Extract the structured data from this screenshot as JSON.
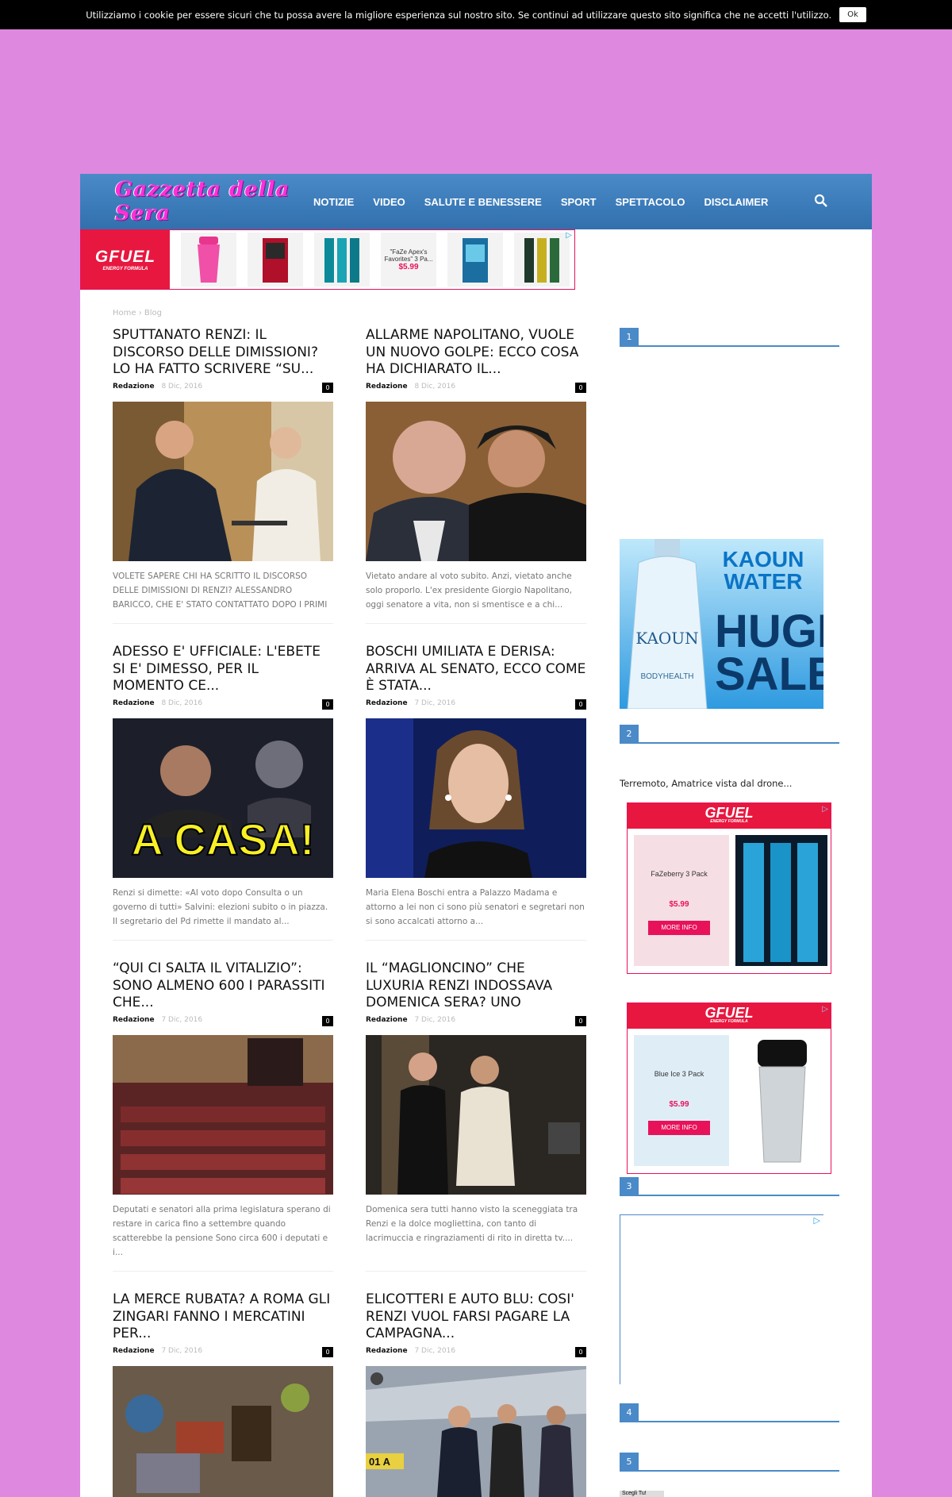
{
  "cookie_bar": {
    "text": "Utilizziamo i cookie per essere sicuri che tu possa avere la migliore esperienza sul nostro sito. Se continui ad utilizzare questo sito significa che ne accetti l'utilizzo.",
    "ok_label": "Ok"
  },
  "header": {
    "logo": "Gazzetta della Sera",
    "nav": [
      "NOTIZIE",
      "VIDEO",
      "SALUTE E BENESSERE",
      "SPORT",
      "SPETTACOLO",
      "DISCLAIMER"
    ],
    "search_icon": "search-icon"
  },
  "ad_banner": {
    "brand": "GFUEL",
    "brand_sub": "ENERGY FORMULA",
    "promo_text": "\"FaZe Apex's Favorites\" 3 Pa...",
    "promo_price": "$5.99"
  },
  "breadcrumb": {
    "home": "Home",
    "sep": "›",
    "current": "Blog"
  },
  "articles": [
    {
      "title": "SPUTTANATO RENZI: IL DISCORSO DELLE DIMISSIONI? LO HA FATTO SCRIVERE “SU...",
      "author": "Redazione",
      "date": "8 Dic, 2016",
      "comments": "0",
      "excerpt": "VOLETE SAPERE CHI HA SCRITTO IL DISCORSO DELLE DIMISSIONI DI RENZI? ALESSANDRO BARICCO, CHE E' STATO CONTATTATO DOPO I PRIMI EXIT POLL – MA..."
    },
    {
      "title": "ALLARME NAPOLITANO, VUOLE UN NUOVO GOLPE: ECCO COSA HA DICHIARATO IL...",
      "author": "Redazione",
      "date": "8 Dic, 2016",
      "comments": "0",
      "excerpt": "Vietato andare al voto subito. Anzi, vietato anche solo proporlo. L'ex presidente Giorgio Napolitano, oggi senatore a vita, non si smentisce e a chi..."
    },
    {
      "title": "ADESSO E' UFFICIALE: L'EBETE SI E' DIMESSO, PER IL MOMENTO CE...",
      "author": "Redazione",
      "date": "8 Dic, 2016",
      "comments": "0",
      "image_text": "A CASA!",
      "excerpt": "Renzi si dimette: «Al voto dopo Consulta o un governo di tutti» Salvini: elezioni subito o in piazza. Il segretario del Pd rimette il mandato al..."
    },
    {
      "title": "BOSCHI UMILIATA E DERISA: ARRIVA AL SENATO, ECCO COME È STATA...",
      "author": "Redazione",
      "date": "7 Dic, 2016",
      "comments": "0",
      "excerpt": "Maria Elena Boschi entra a Palazzo Madama e attorno a lei non ci sono più senatori e segretari non si sono accalcati attorno a..."
    },
    {
      "title": "“QUI CI SALTA IL VITALIZIO”: SONO ALMENO 600 I PARASSITI CHE...",
      "author": "Redazione",
      "date": "7 Dic, 2016",
      "comments": "0",
      "excerpt": "Deputati e senatori alla prima legislatura sperano di restare in carica fino a settembre quando scatterebbe la pensione Sono circa 600 i deputati e i..."
    },
    {
      "title": "IL “MAGLIONCINO” CHE LUXURIA RENZI INDOSSAVA DOMENICA SERA? UNO SCHIAFFO ALLA...",
      "author": "Redazione",
      "date": "7 Dic, 2016",
      "comments": "0",
      "excerpt": "Domenica sera tutti hanno visto la sceneggiata tra Renzi e la dolce mogliettina, con tanto di lacrimuccia e ringraziamenti di rito in diretta tv...."
    },
    {
      "title": "LA MERCE RUBATA? A ROMA GLI ZINGARI FANNO I MERCATINI PER...",
      "author": "Redazione",
      "date": "7 Dic, 2016",
      "comments": "0",
      "excerpt": ""
    },
    {
      "title": "ELICOTTERI E AUTO BLU: COSI' RENZI VUOL FARSI PAGARE LA CAMPAGNA...",
      "author": "Redazione",
      "date": "7 Dic, 2016",
      "comments": "0",
      "image_text": "01 A",
      "excerpt": ""
    }
  ],
  "sidebar": {
    "blocks": [
      "1",
      "2",
      "3",
      "4",
      "5"
    ],
    "kaoun": {
      "title": "KAOUN WATER",
      "headline": "HUGE SALE",
      "bottle_brand": "KAOUN",
      "sub_brand": "BODYHEALTH"
    },
    "caption": "Terremoto, Amatrice vista dal drone...",
    "gfuel_ads": [
      {
        "brand": "GFUEL",
        "sub": "ENERGY FORMULA",
        "product": "FaZeberry 3 Pack",
        "price": "$5.99",
        "cta": "MORE INFO"
      },
      {
        "brand": "GFUEL",
        "sub": "ENERGY FORMULA",
        "product": "Blue Ice 3 Pack",
        "price": "$5.99",
        "cta": "MORE INFO"
      }
    ],
    "tiny_label": "Scegli Tu!"
  },
  "colors": {
    "page_bg": "#df88e0",
    "nav_blue": "#3b7dbd",
    "accent_pink": "#e8125a"
  }
}
